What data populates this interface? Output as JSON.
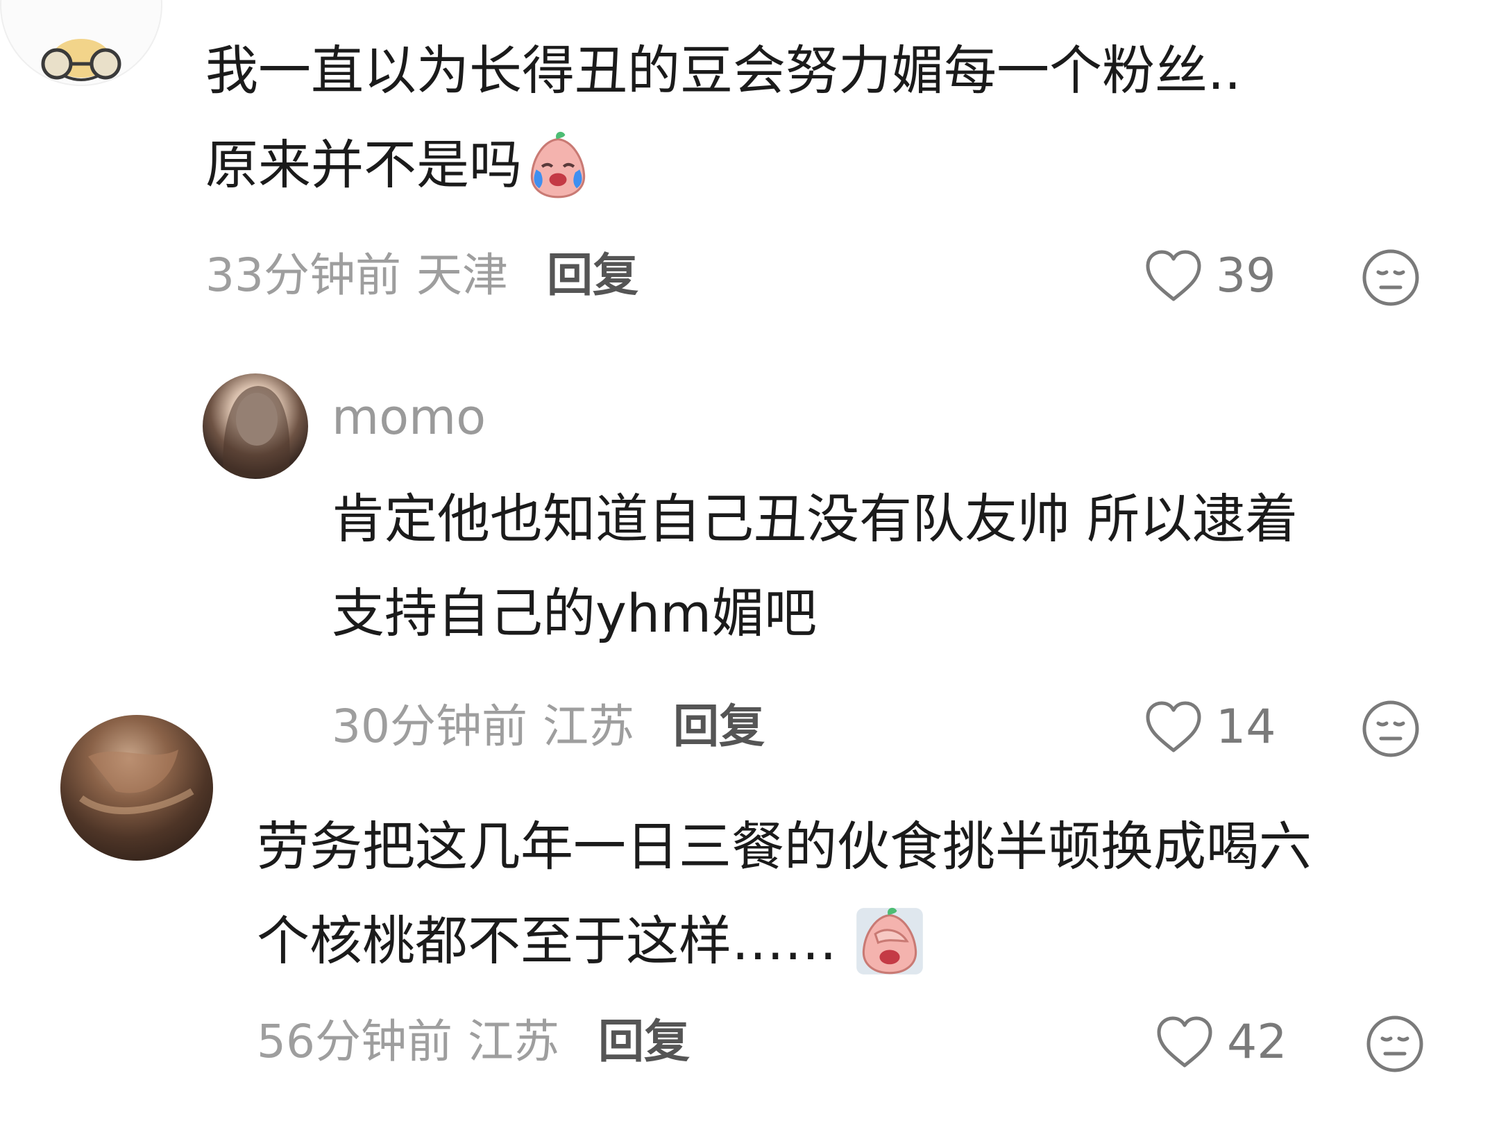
{
  "comments": [
    {
      "text": "我一直以为长得丑的豆会努力媚每一个粉丝..\n原来并不是吗",
      "emoji": "crying-pear-emoji",
      "time": "33分钟前",
      "location": "天津",
      "reply_label": "回复",
      "likes": "39"
    },
    {
      "username": "momo",
      "text": "肯定他也知道自己丑没有队友帅 所以逮着\n支持自己的yhm媚吧",
      "time": "30分钟前",
      "location": "江苏",
      "reply_label": "回复",
      "likes": "14"
    },
    {
      "text": "劳务把这几年一日三餐的伙食挑半顿换成喝六\n个核桃都不至于这样……",
      "emoji": "facepalm-pear-emoji",
      "time": "56分钟前",
      "location": "江苏",
      "reply_label": "回复",
      "likes": "42"
    }
  ],
  "icons": {
    "like": "heart-outline-icon",
    "dislike": "meh-face-icon"
  },
  "colors": {
    "text": "#1b1b1b",
    "meta": "#9e9e9e",
    "reply": "#555555",
    "icon": "#7a7a7a"
  }
}
